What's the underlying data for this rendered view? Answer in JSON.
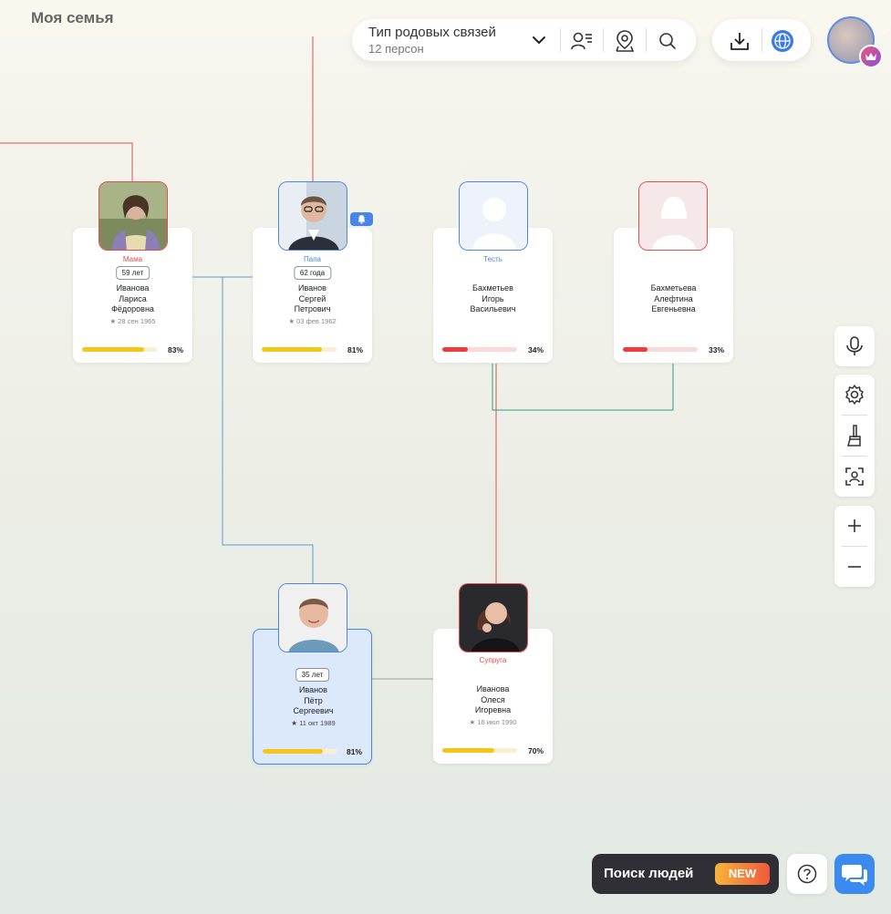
{
  "app": {
    "title": "Моя семья"
  },
  "toolbar": {
    "relation_type_label": "Тип родовых связей",
    "persons_count": "12 персон",
    "icons": [
      "chevron-down-icon",
      "person-list-icon",
      "map-pin-icon",
      "search-icon",
      "download-icon",
      "globe-icon"
    ]
  },
  "colors": {
    "female_border": "#e24d4d",
    "male_border": "#4a86e6",
    "progress_yellow": "#f5c518",
    "progress_red": "#ef3b3b",
    "selected_bg": "#dce9fb",
    "line_red": "#d9534f",
    "line_blue": "#5b9bd5",
    "line_teal": "#2a9d8f",
    "line_gray": "#a0a0a0"
  },
  "persons": [
    {
      "role": "Мама",
      "age": "59 лет",
      "name": "Иванова\nЛариса\nФёдоровна",
      "date": "28 сен 1965",
      "progress": 83,
      "progress_label": "83%"
    },
    {
      "role": "Папа",
      "age": "62 года",
      "name": "Иванов\nСергей\nПетрович",
      "date": "03 фев 1962",
      "progress": 81,
      "progress_label": "81%"
    },
    {
      "role": "Тесть",
      "name": "Бахметьев\nИгорь\nВасильевич",
      "progress": 34,
      "progress_label": "34%"
    },
    {
      "role": "",
      "name": "Бахметьева\nАлефтина\nЕвгеньевна",
      "progress": 33,
      "progress_label": "33%"
    },
    {
      "role": "",
      "age": "35 лет",
      "name": "Иванов\nПётр\nСергеевич",
      "date": "11 окт 1989",
      "progress": 81,
      "progress_label": "81%"
    },
    {
      "role": "Супруга",
      "name": "Иванова\nОлеся\nИгоревна",
      "date": "16 июл 1990",
      "progress": 70,
      "progress_label": "70%"
    }
  ],
  "side_tools": [
    "microphone-icon",
    "gear-icon",
    "brush-icon",
    "face-scan-icon",
    "zoom-in-icon",
    "zoom-out-icon"
  ],
  "bottom": {
    "search_people_label": "Поиск людей",
    "new_badge": "NEW"
  }
}
